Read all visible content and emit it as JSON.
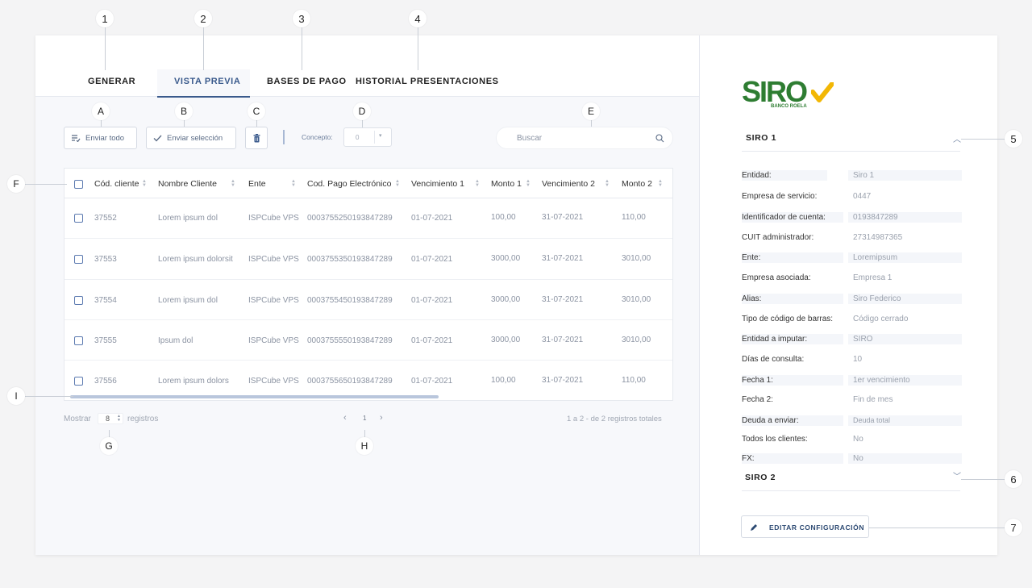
{
  "tabs": [
    {
      "label": "GENERAR"
    },
    {
      "label": "VISTA PREVIA"
    },
    {
      "label": "BASES DE PAGO"
    },
    {
      "label": "HISTORIAL PRESENTACIONES"
    }
  ],
  "toolbar": {
    "send_all": "Enviar todo",
    "send_selection": "Enviar selección",
    "concept_label": "Concepto:",
    "concept_value": "0",
    "search_placeholder": "Buscar"
  },
  "table": {
    "columns": [
      "Cód. cliente",
      "Nombre Cliente",
      "Ente",
      "Cod. Pago Electrónico",
      "Vencimiento 1",
      "Monto 1",
      "Vencimiento 2",
      "Monto 2"
    ],
    "rows": [
      [
        "37552",
        "Lorem ipsum dol",
        "ISPCube VPS",
        "0003755250193847289",
        "01-07-2021",
        "100,00",
        "31-07-2021",
        "110,00"
      ],
      [
        "37553",
        "Lorem ipsum dolorsit",
        "ISPCube VPS",
        "0003755350193847289",
        "01-07-2021",
        "3000,00",
        "31-07-2021",
        "3010,00"
      ],
      [
        "37554",
        "Lorem ipsum dol",
        "ISPCube VPS",
        "0003755450193847289",
        "01-07-2021",
        "3000,00",
        "31-07-2021",
        "3010,00"
      ],
      [
        "37555",
        "Ipsum dol",
        "ISPCube VPS",
        "0003755550193847289",
        "01-07-2021",
        "3000,00",
        "31-07-2021",
        "3010,00"
      ],
      [
        "37556",
        "Lorem ipsum dolors",
        "ISPCube VPS",
        "0003755650193847289",
        "01-07-2021",
        "100,00",
        "31-07-2021",
        "110,00"
      ]
    ]
  },
  "footer": {
    "show_label": "Mostrar",
    "show_value": "8",
    "records_label": "registros",
    "page": "1",
    "totals": "1 a 2 - de 2 registros totales"
  },
  "right": {
    "logo_text": "SIRO",
    "logo_sub": "BANCO ROELA",
    "section1_title": "SIRO 1",
    "section2_title": "SIRO 2",
    "fields": [
      {
        "label": "Entidad:",
        "value": "Siro 1"
      },
      {
        "label": "Empresa de servicio:",
        "value": "0447"
      },
      {
        "label": "Identificador de cuenta:",
        "value": "0193847289"
      },
      {
        "label": "CUIT administrador:",
        "value": "27314987365"
      },
      {
        "label": "Ente:",
        "value": "Loremipsum"
      },
      {
        "label": "Empresa asociada:",
        "value": "Empresa 1"
      },
      {
        "label": "Alias:",
        "value": "Siro Federico"
      },
      {
        "label": "Tipo de código de barras:",
        "value": "Código cerrado"
      },
      {
        "label": "Entidad a imputar:",
        "value": "SIRO"
      },
      {
        "label": "Días de consulta:",
        "value": "10"
      },
      {
        "label": "Fecha 1:",
        "value": "1er vencimiento"
      },
      {
        "label": "Fecha 2:",
        "value": "Fin de mes"
      },
      {
        "label": "Deuda a enviar:",
        "value": "Deuda total"
      },
      {
        "label": "Todos los clientes:",
        "value": "No"
      },
      {
        "label": "FX:",
        "value": "No"
      }
    ],
    "edit_button": "EDITAR CONFIGURACIÓN"
  },
  "callouts": {
    "n1": "1",
    "n2": "2",
    "n3": "3",
    "n4": "4",
    "n5": "5",
    "n6": "6",
    "n7": "7",
    "a": "A",
    "b": "B",
    "c": "C",
    "d": "D",
    "e": "E",
    "f": "F",
    "g": "G",
    "h": "H",
    "i": "I"
  },
  "colors": {
    "accent": "#3a5a8c",
    "logo_green": "#2e7d32",
    "logo_yellow": "#f2b705"
  }
}
